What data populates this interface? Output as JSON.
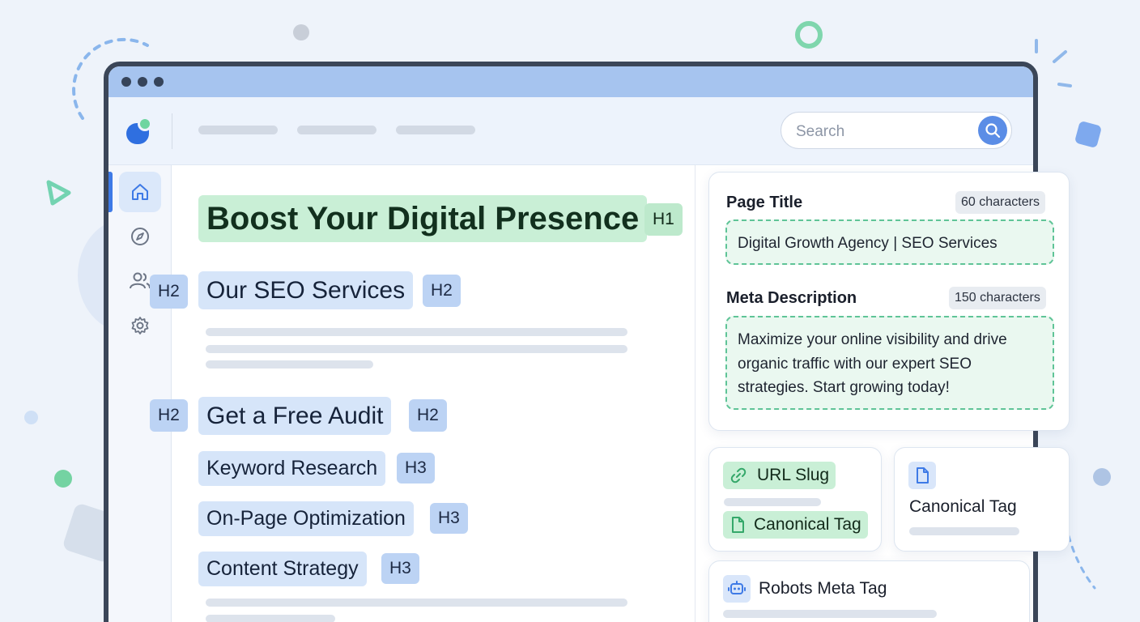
{
  "search": {
    "placeholder": "Search"
  },
  "headings": {
    "h1_text": "Boost Your Digital Presence",
    "h1_badge": "H1",
    "h2_left_badge_1": "H2",
    "h2_1_text": "Our SEO Services",
    "h2_1_badge": "H2",
    "h2_left_badge_2": "H2",
    "h2_2_text": "Get a Free Audit",
    "h2_2_badge": "H2",
    "h3": [
      {
        "text": "Keyword Research",
        "badge": "H3"
      },
      {
        "text": "On-Page Optimization",
        "badge": "H3"
      },
      {
        "text": "Content Strategy",
        "badge": "H3"
      }
    ]
  },
  "meta_panel": {
    "page_title_label": "Page Title",
    "page_title_count": "60 characters",
    "page_title_value": "Digital Growth Agency | SEO Services",
    "meta_desc_label": "Meta Description",
    "meta_desc_count": "150 characters",
    "meta_desc_value": "Maximize your online visibility and drive organic traffic with our expert SEO strategies. Start growing today!"
  },
  "url_card": {
    "url_slug_label": "URL Slug",
    "canonical_label": "Canonical Tag"
  },
  "canonical_card": {
    "title": "Canonical Tag"
  },
  "robots_card": {
    "title": "Robots Meta Tag"
  },
  "colors": {
    "accent_blue": "#3e7ae6",
    "accent_green": "#6ed5a0",
    "window_frame": "#3b4658"
  }
}
